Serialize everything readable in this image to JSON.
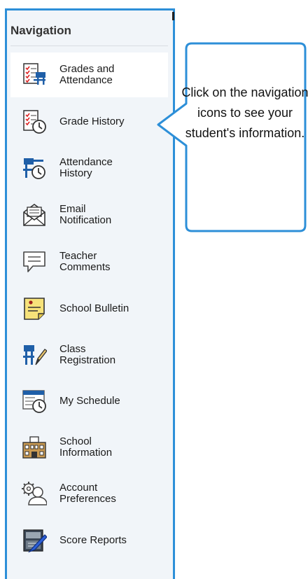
{
  "navigation": {
    "title": "Navigation",
    "items": [
      {
        "label": "Grades and\nAttendance",
        "icon": "grades-attendance-icon",
        "active": true
      },
      {
        "label": "Grade History",
        "icon": "grade-history-icon"
      },
      {
        "label": "Attendance\nHistory",
        "icon": "attendance-history-icon"
      },
      {
        "label": "Email\nNotification",
        "icon": "email-notification-icon"
      },
      {
        "label": "Teacher\nComments",
        "icon": "teacher-comments-icon"
      },
      {
        "label": "School Bulletin",
        "icon": "school-bulletin-icon"
      },
      {
        "label": "Class\nRegistration",
        "icon": "class-registration-icon"
      },
      {
        "label": "My Schedule",
        "icon": "my-schedule-icon"
      },
      {
        "label": "School\nInformation",
        "icon": "school-information-icon"
      },
      {
        "label": "Account\nPreferences",
        "icon": "account-preferences-icon"
      },
      {
        "label": "Score Reports",
        "icon": "score-reports-icon"
      }
    ]
  },
  "callout": {
    "text": "Click on the navigation icons to see your student's information."
  },
  "colors": {
    "panel_border": "#2d8fd8",
    "panel_bg": "#f1f5f9",
    "callout_border": "#2d8fd8",
    "icon_blue": "#1f5fa8"
  }
}
